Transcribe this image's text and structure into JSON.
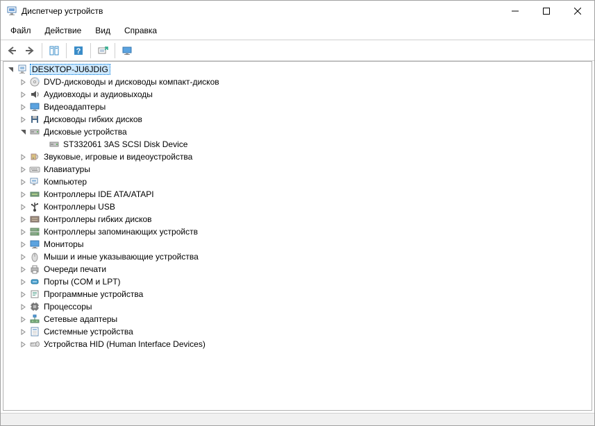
{
  "window": {
    "title": "Диспетчер устройств"
  },
  "menu": {
    "file": "Файл",
    "action": "Действие",
    "view": "Вид",
    "help": "Справка"
  },
  "tree": {
    "root": "DESKTOP-JU6JDIG",
    "categories": [
      {
        "label": "DVD-дисководы и дисководы компакт-дисков",
        "icon": "disc",
        "expanded": false
      },
      {
        "label": "Аудиовходы и аудиовыходы",
        "icon": "speaker",
        "expanded": false
      },
      {
        "label": "Видеоадаптеры",
        "icon": "display",
        "expanded": false
      },
      {
        "label": "Дисководы гибких дисков",
        "icon": "floppy",
        "expanded": false
      },
      {
        "label": "Дисковые устройства",
        "icon": "hdd",
        "expanded": true,
        "children": [
          {
            "label": "ST332061 3AS SCSI Disk Device",
            "icon": "hdd"
          }
        ]
      },
      {
        "label": "Звуковые, игровые и видеоустройства",
        "icon": "sound",
        "expanded": false
      },
      {
        "label": "Клавиатуры",
        "icon": "keyboard",
        "expanded": false
      },
      {
        "label": "Компьютер",
        "icon": "computer",
        "expanded": false
      },
      {
        "label": "Контроллеры IDE ATA/ATAPI",
        "icon": "ide",
        "expanded": false
      },
      {
        "label": "Контроллеры USB",
        "icon": "usb",
        "expanded": false
      },
      {
        "label": "Контроллеры гибких дисков",
        "icon": "floppyctrl",
        "expanded": false
      },
      {
        "label": "Контроллеры запоминающих устройств",
        "icon": "storage",
        "expanded": false
      },
      {
        "label": "Мониторы",
        "icon": "monitor",
        "expanded": false
      },
      {
        "label": "Мыши и иные указывающие устройства",
        "icon": "mouse",
        "expanded": false
      },
      {
        "label": "Очереди печати",
        "icon": "printer",
        "expanded": false
      },
      {
        "label": "Порты (COM и LPT)",
        "icon": "port",
        "expanded": false
      },
      {
        "label": "Программные устройства",
        "icon": "software",
        "expanded": false
      },
      {
        "label": "Процессоры",
        "icon": "cpu",
        "expanded": false
      },
      {
        "label": "Сетевые адаптеры",
        "icon": "network",
        "expanded": false
      },
      {
        "label": "Системные устройства",
        "icon": "system",
        "expanded": false
      },
      {
        "label": "Устройства HID (Human Interface Devices)",
        "icon": "hid",
        "expanded": false
      }
    ]
  }
}
